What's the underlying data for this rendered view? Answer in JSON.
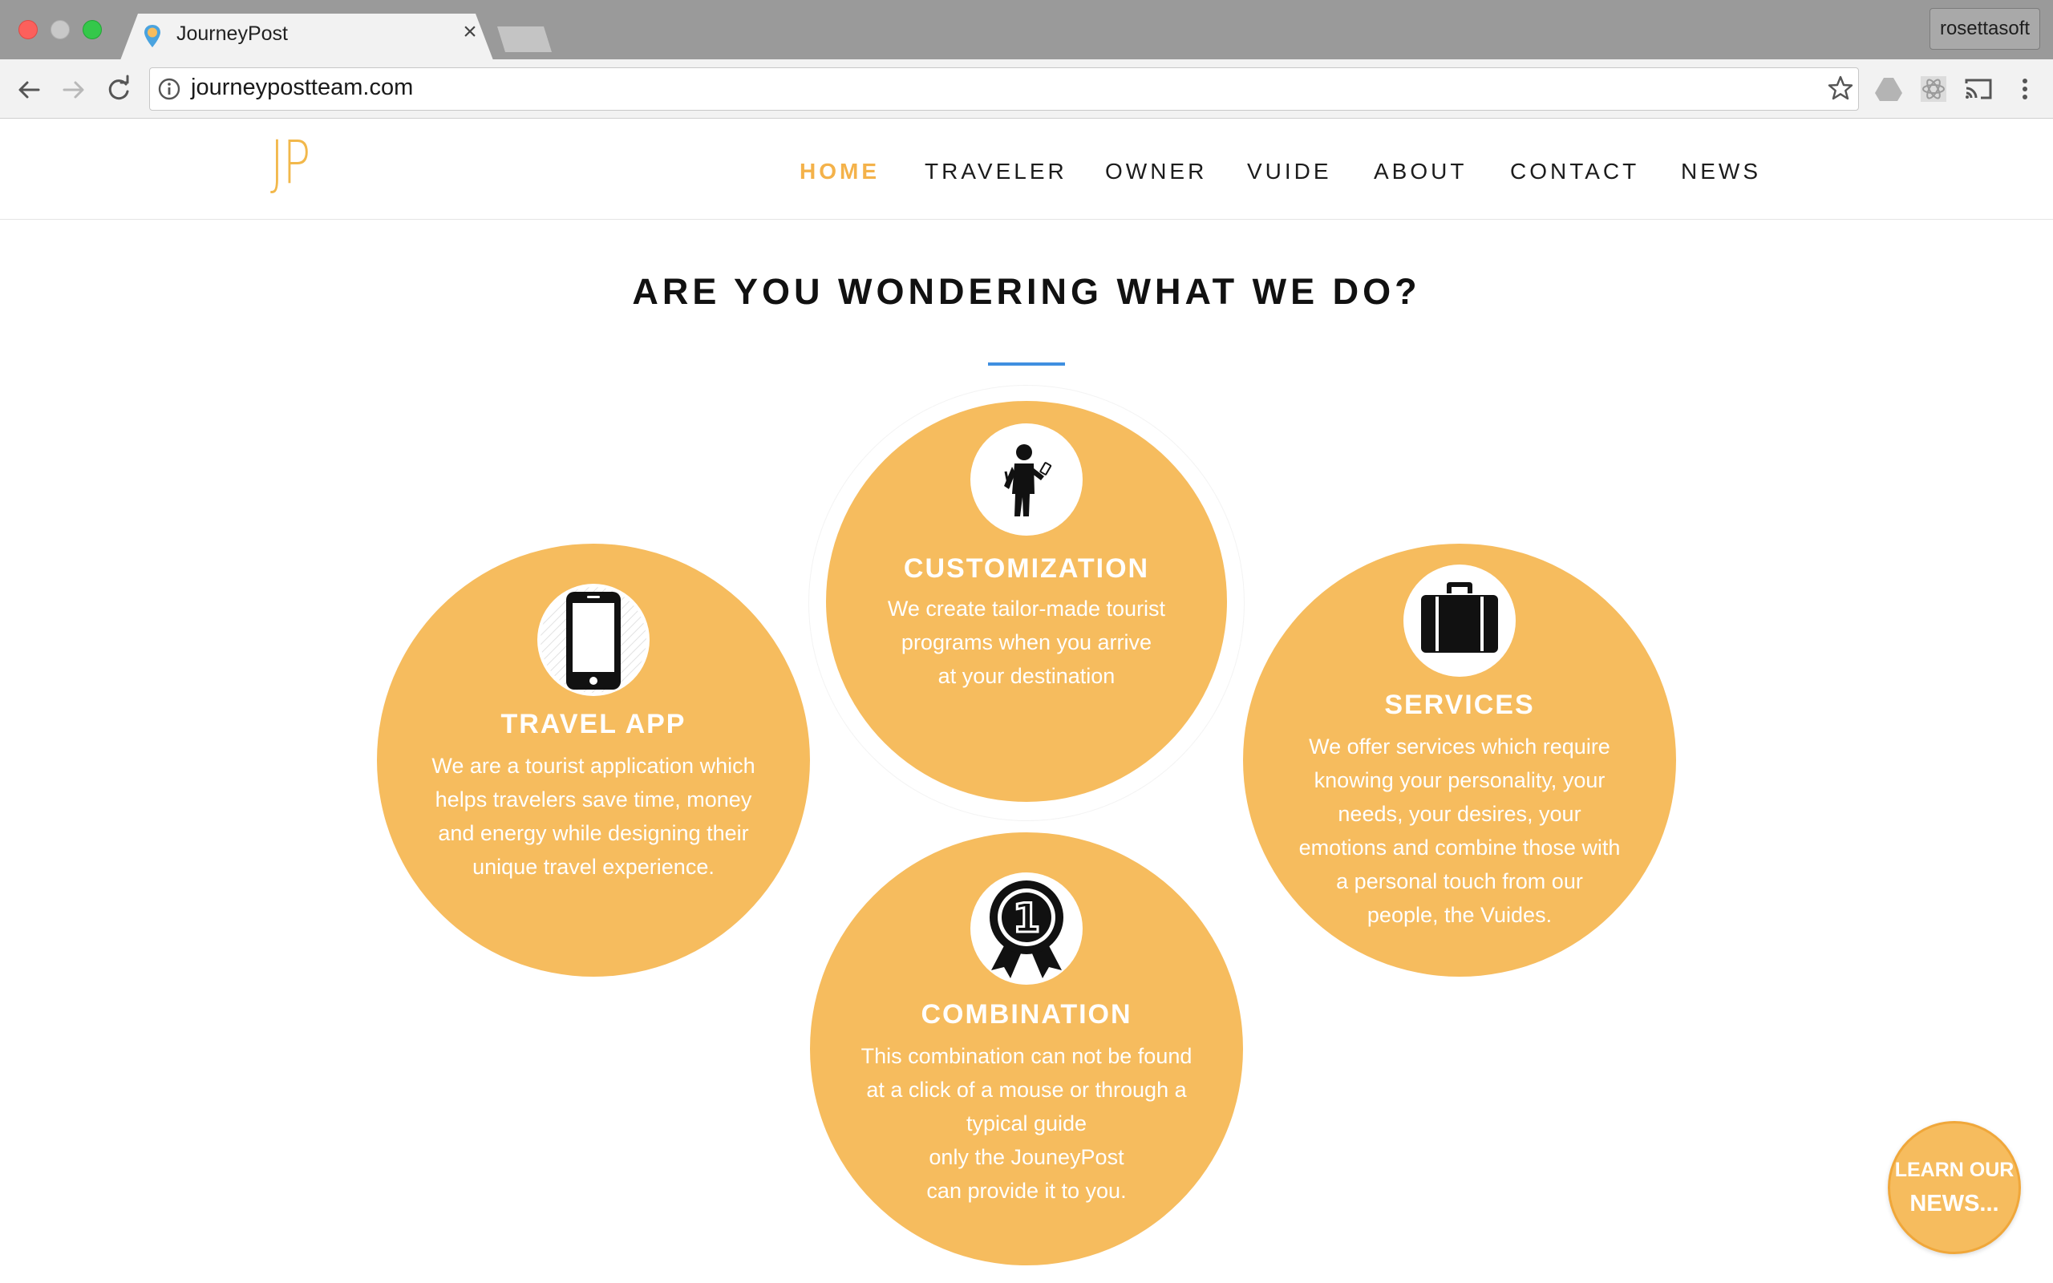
{
  "browser": {
    "tab_title": "JourneyPost",
    "tab_close": "×",
    "url": "journeypostteam.com",
    "profile": "rosettasoft"
  },
  "site": {
    "logo": "JP",
    "nav": [
      {
        "label": "HOME",
        "active": true
      },
      {
        "label": "TRAVELER"
      },
      {
        "label": "OWNER"
      },
      {
        "label": "VUIDE"
      },
      {
        "label": "ABOUT"
      },
      {
        "label": "CONTACT"
      },
      {
        "label": "NEWS"
      }
    ],
    "accent_color": "#f6bc5e"
  },
  "section": {
    "title": "ARE YOU WONDERING WHAT WE DO?",
    "cards": {
      "customization": {
        "title": "CUSTOMIZATION",
        "body": "We create tailor-made tourist\nprograms when you arrive\nat your destination",
        "icon": "traveler-icon"
      },
      "travel_app": {
        "title": "TRAVEL APP",
        "body": "We are a tourist application  which\nhelps travelers save time, money\nand energy while designing their\nunique travel experience.",
        "icon": "smartphone-icon"
      },
      "services": {
        "title": "SERVICES",
        "body": "We offer services which require\nknowing your personality, your\nneeds, your desires, your\nemotions and combine those with\na personal touch from our\npeople, the Vuides.",
        "icon": "suitcase-icon"
      },
      "combination": {
        "title": "COMBINATION",
        "body": "This combination can not be found\nat a click of a mouse or through a\ntypical guide\nonly the JouneyPost\ncan provide it to you.",
        "icon": "award-ribbon-icon"
      }
    }
  },
  "learn_button": {
    "line1": "LEARN OUR",
    "line2": "NEWS..."
  }
}
